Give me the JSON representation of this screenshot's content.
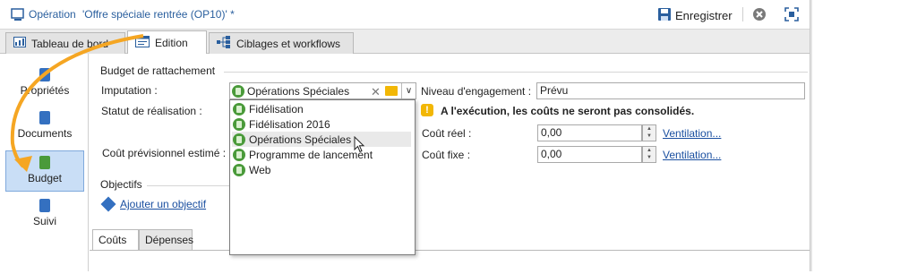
{
  "window": {
    "title_prefix": "Opération",
    "title_name": "'Offre spéciale rentrée (OP10)' *",
    "save_label": "Enregistrer"
  },
  "tabs": [
    {
      "label": "Tableau de bord"
    },
    {
      "label": "Edition"
    },
    {
      "label": "Ciblages et workflows"
    }
  ],
  "nav": {
    "items": [
      {
        "label": "Propriétés"
      },
      {
        "label": "Documents"
      },
      {
        "label": "Budget"
      },
      {
        "label": "Suivi"
      }
    ]
  },
  "budget": {
    "group_title": "Budget de rattachement",
    "imputation_label": "Imputation :",
    "imputation_value": "Opérations Spéciales",
    "statut_label": "Statut de réalisation :",
    "cout_prev_label": "Coût prévisionnel estimé :",
    "niveau_label": "Niveau d'engagement :",
    "niveau_value": "Prévu",
    "warning": "A l'exécution, les coûts ne seront pas consolidés.",
    "cout_reel_label": "Coût réel :",
    "cout_reel_value": "0,00",
    "cout_fixe_label": "Coût fixe :",
    "cout_fixe_value": "0,00",
    "ventilation_1": "Ventilation...",
    "ventilation_2": "Ventilation..."
  },
  "dropdown_options": [
    {
      "label": "Fidélisation"
    },
    {
      "label": "Fidélisation 2016"
    },
    {
      "label": "Opérations Spéciales"
    },
    {
      "label": "Programme de lancement"
    },
    {
      "label": "Web"
    }
  ],
  "objectifs": {
    "group_title": "Objectifs",
    "add_link": "Ajouter un objectif"
  },
  "bottom_tabs": [
    {
      "label": "Coûts"
    },
    {
      "label": "Dépenses"
    }
  ],
  "colors": {
    "accent_blue": "#2a5f9e",
    "nav_selected": "#c9def6",
    "annotation_orange": "#f5a623",
    "budget_green": "#4a9a3a",
    "warning_yellow": "#f2b705"
  }
}
